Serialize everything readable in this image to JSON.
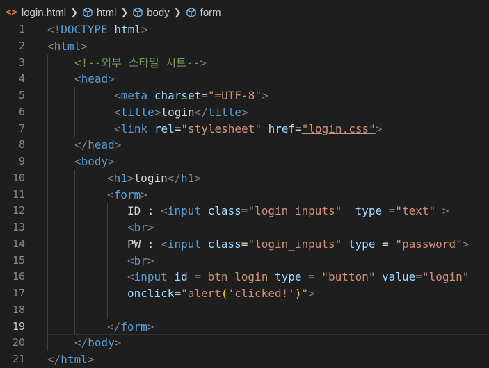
{
  "breadcrumb": {
    "file": "login.html",
    "file_icon": "<>",
    "items": [
      "html",
      "body",
      "form"
    ]
  },
  "lines": [
    {
      "n": "1",
      "indent": 0,
      "tokens": [
        {
          "c": "p",
          "t": "<!"
        },
        {
          "c": "t",
          "t": "DOCTYPE"
        },
        {
          "c": "x",
          "t": " "
        },
        {
          "c": "a",
          "t": "html"
        },
        {
          "c": "p",
          "t": ">"
        }
      ]
    },
    {
      "n": "2",
      "indent": 0,
      "tokens": [
        {
          "c": "p",
          "t": "<"
        },
        {
          "c": "t",
          "t": "html"
        },
        {
          "c": "p",
          "t": ">"
        }
      ]
    },
    {
      "n": "3",
      "indent": 1,
      "tokens": [
        {
          "c": "c",
          "t": "<!--외부 스타일 시트-->"
        }
      ]
    },
    {
      "n": "4",
      "indent": 1,
      "tokens": [
        {
          "c": "p",
          "t": "<"
        },
        {
          "c": "t",
          "t": "head"
        },
        {
          "c": "p",
          "t": ">"
        }
      ]
    },
    {
      "n": "5",
      "indent": 2,
      "tokens": [
        {
          "c": "p",
          "t": "<"
        },
        {
          "c": "t",
          "t": "meta"
        },
        {
          "c": "x",
          "t": " "
        },
        {
          "c": "a",
          "t": "charset"
        },
        {
          "c": "x",
          "t": "="
        },
        {
          "c": "s",
          "t": "\"=UTF-8\""
        },
        {
          "c": "p",
          "t": ">"
        }
      ]
    },
    {
      "n": "6",
      "indent": 2,
      "tokens": [
        {
          "c": "p",
          "t": "<"
        },
        {
          "c": "t",
          "t": "title"
        },
        {
          "c": "p",
          "t": ">"
        },
        {
          "c": "x",
          "t": "login"
        },
        {
          "c": "p",
          "t": "</"
        },
        {
          "c": "t",
          "t": "title"
        },
        {
          "c": "p",
          "t": ">"
        }
      ]
    },
    {
      "n": "7",
      "indent": 2,
      "tokens": [
        {
          "c": "p",
          "t": "<"
        },
        {
          "c": "t",
          "t": "link"
        },
        {
          "c": "x",
          "t": " "
        },
        {
          "c": "a",
          "t": "rel"
        },
        {
          "c": "x",
          "t": "="
        },
        {
          "c": "s",
          "t": "\"stylesheet\""
        },
        {
          "c": "x",
          "t": " "
        },
        {
          "c": "a",
          "t": "href"
        },
        {
          "c": "x",
          "t": "="
        },
        {
          "c": "s u",
          "t": "\"login.css\""
        },
        {
          "c": "p",
          "t": ">"
        }
      ]
    },
    {
      "n": "8",
      "indent": 1,
      "tokens": [
        {
          "c": "p",
          "t": "</"
        },
        {
          "c": "t",
          "t": "head"
        },
        {
          "c": "p",
          "t": ">"
        }
      ]
    },
    {
      "n": "9",
      "indent": 1,
      "tokens": [
        {
          "c": "p",
          "t": "<"
        },
        {
          "c": "t",
          "t": "body"
        },
        {
          "c": "p",
          "t": ">"
        }
      ]
    },
    {
      "n": "10",
      "indent": 3,
      "tokens": [
        {
          "c": "p",
          "t": "<"
        },
        {
          "c": "t",
          "t": "h1"
        },
        {
          "c": "p",
          "t": ">"
        },
        {
          "c": "x",
          "t": "login"
        },
        {
          "c": "p",
          "t": "</"
        },
        {
          "c": "t",
          "t": "h1"
        },
        {
          "c": "p",
          "t": ">"
        }
      ]
    },
    {
      "n": "11",
      "indent": 3,
      "tokens": [
        {
          "c": "p",
          "t": "<"
        },
        {
          "c": "t",
          "t": "form"
        },
        {
          "c": "p",
          "t": ">"
        }
      ]
    },
    {
      "n": "12",
      "indent": 4,
      "tokens": [
        {
          "c": "x",
          "t": "ID : "
        },
        {
          "c": "p",
          "t": "<"
        },
        {
          "c": "t",
          "t": "input"
        },
        {
          "c": "x",
          "t": " "
        },
        {
          "c": "a",
          "t": "class"
        },
        {
          "c": "x",
          "t": "="
        },
        {
          "c": "s",
          "t": "\"login_inputs\""
        },
        {
          "c": "x",
          "t": "  "
        },
        {
          "c": "a",
          "t": "type"
        },
        {
          "c": "x",
          "t": " ="
        },
        {
          "c": "s",
          "t": "\"text\""
        },
        {
          "c": "x",
          "t": " "
        },
        {
          "c": "p",
          "t": ">"
        }
      ]
    },
    {
      "n": "13",
      "indent": 4,
      "tokens": [
        {
          "c": "p",
          "t": "<"
        },
        {
          "c": "t",
          "t": "br"
        },
        {
          "c": "p",
          "t": ">"
        }
      ]
    },
    {
      "n": "14",
      "indent": 4,
      "tokens": [
        {
          "c": "x",
          "t": "PW : "
        },
        {
          "c": "p",
          "t": "<"
        },
        {
          "c": "t",
          "t": "input"
        },
        {
          "c": "x",
          "t": " "
        },
        {
          "c": "a",
          "t": "class"
        },
        {
          "c": "x",
          "t": "="
        },
        {
          "c": "s",
          "t": "\"login_inputs\""
        },
        {
          "c": "x",
          "t": " "
        },
        {
          "c": "a",
          "t": "type"
        },
        {
          "c": "x",
          "t": " = "
        },
        {
          "c": "s",
          "t": "\"password\""
        },
        {
          "c": "p",
          "t": ">"
        }
      ]
    },
    {
      "n": "15",
      "indent": 4,
      "tokens": [
        {
          "c": "p",
          "t": "<"
        },
        {
          "c": "t",
          "t": "br"
        },
        {
          "c": "p",
          "t": ">"
        }
      ]
    },
    {
      "n": "16",
      "indent": 4,
      "tokens": [
        {
          "c": "p",
          "t": "<"
        },
        {
          "c": "t",
          "t": "input"
        },
        {
          "c": "x",
          "t": " "
        },
        {
          "c": "a",
          "t": "id"
        },
        {
          "c": "x",
          "t": " = "
        },
        {
          "c": "s",
          "t": "btn_login"
        },
        {
          "c": "x",
          "t": " "
        },
        {
          "c": "a",
          "t": "type"
        },
        {
          "c": "x",
          "t": " = "
        },
        {
          "c": "s",
          "t": "\"button\""
        },
        {
          "c": "x",
          "t": " "
        },
        {
          "c": "a",
          "t": "value"
        },
        {
          "c": "x",
          "t": "="
        },
        {
          "c": "s",
          "t": "\"login\""
        }
      ]
    },
    {
      "n": "17",
      "indent": 4,
      "tokens": [
        {
          "c": "a",
          "t": "onclick"
        },
        {
          "c": "x",
          "t": "="
        },
        {
          "c": "s",
          "t": "\"alert"
        },
        {
          "c": "y",
          "t": "("
        },
        {
          "c": "s",
          "t": "'clicked!'"
        },
        {
          "c": "y",
          "t": ")"
        },
        {
          "c": "s",
          "t": "\""
        },
        {
          "c": "p",
          "t": ">"
        }
      ]
    },
    {
      "n": "18",
      "indent": 4,
      "tokens": []
    },
    {
      "n": "19",
      "indent": 3,
      "current": true,
      "tokens": [
        {
          "c": "p",
          "t": "</"
        },
        {
          "c": "t",
          "t": "form"
        },
        {
          "c": "p",
          "t": ">"
        }
      ]
    },
    {
      "n": "20",
      "indent": 1,
      "tokens": [
        {
          "c": "p",
          "t": "</"
        },
        {
          "c": "t",
          "t": "body"
        },
        {
          "c": "p",
          "t": ">"
        }
      ]
    },
    {
      "n": "21",
      "indent": 0,
      "tokens": [
        {
          "c": "p",
          "t": "</"
        },
        {
          "c": "t",
          "t": "html"
        },
        {
          "c": "p",
          "t": ">"
        }
      ]
    }
  ],
  "icons": {
    "breadcrumb_symbol": "cube-icon"
  }
}
